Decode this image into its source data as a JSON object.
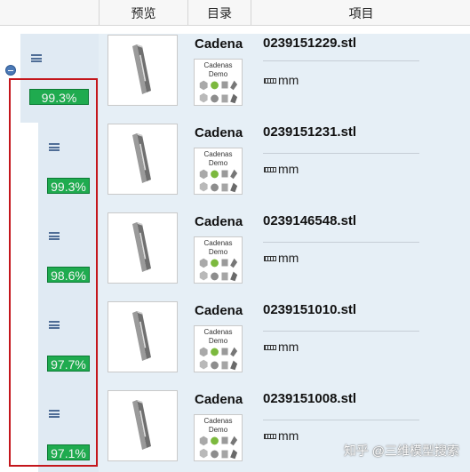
{
  "header": {
    "preview": "预览",
    "catalog": "目录",
    "item": "項目"
  },
  "rows": [
    {
      "match": "99.3%",
      "catalog": "Cadena",
      "logo_text": "Cadenas Demo",
      "title": "0239151229.stl",
      "unit": "mm"
    },
    {
      "match": "99.3%",
      "catalog": "Cadena",
      "logo_text": "Cadenas Demo",
      "title": "0239151231.stl",
      "unit": "mm"
    },
    {
      "match": "98.6%",
      "catalog": "Cadena",
      "logo_text": "Cadenas Demo",
      "title": "0239146548.stl",
      "unit": "mm"
    },
    {
      "match": "97.7%",
      "catalog": "Cadena",
      "logo_text": "Cadenas Demo",
      "title": "0239151010.stl",
      "unit": "mm"
    },
    {
      "match": "97.1%",
      "catalog": "Cadena",
      "logo_text": "Cadenas Demo",
      "title": "0239151008.stl",
      "unit": "mm"
    }
  ],
  "watermark": "知乎 @三维模型搜索",
  "colors": {
    "row_bg": "#e6eff6",
    "match_badge": "#1fab4f",
    "selection_border": "#c4161c"
  }
}
